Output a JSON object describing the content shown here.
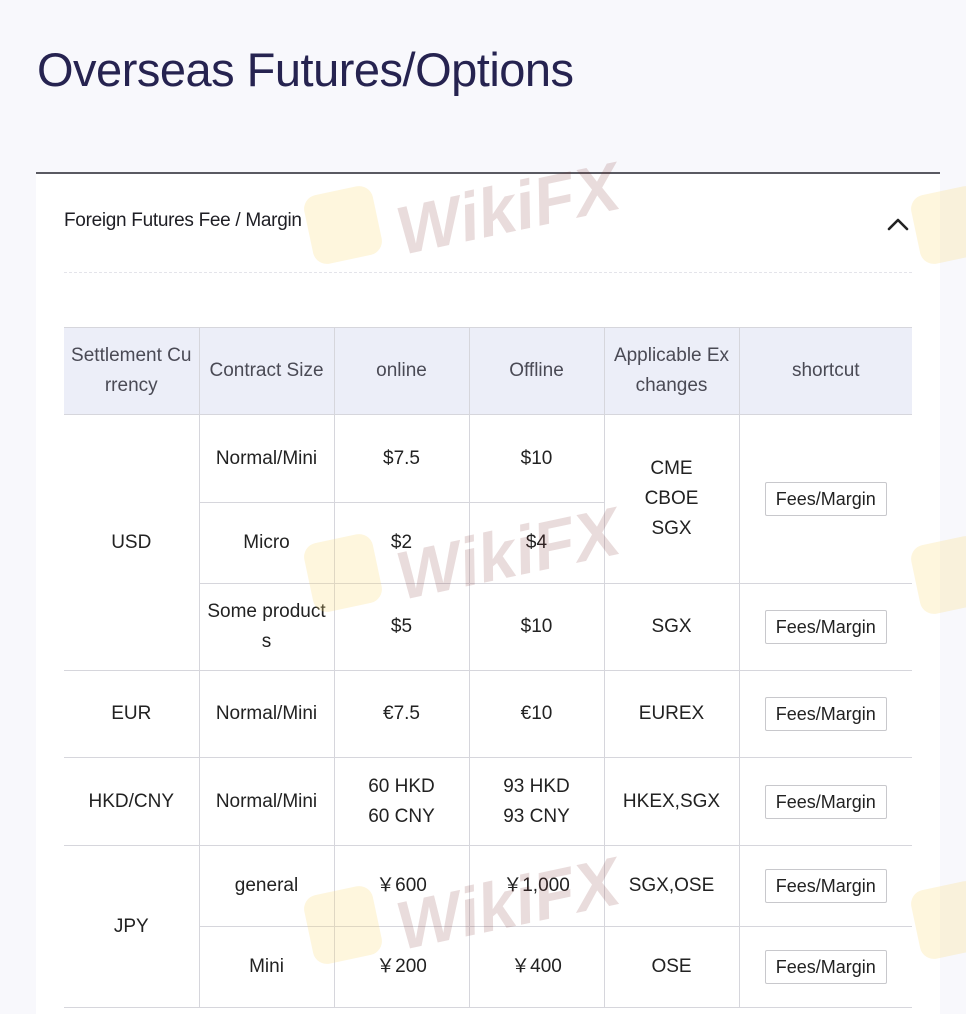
{
  "page": {
    "title": "Overseas Futures/Options"
  },
  "accordion": {
    "title": "Foreign Futures Fee / Margin",
    "toggle_icon": "chevron-up-icon",
    "expanded": true
  },
  "table": {
    "headers": [
      "Settlement Currency",
      "Contract Size",
      "online",
      "Offline",
      "Applicable Exchanges",
      "shortcut"
    ],
    "groups": [
      {
        "currency": "USD",
        "rows": [
          {
            "contract_size": "Normal/Mini",
            "online": "$7.5",
            "offline": "$10"
          },
          {
            "contract_size": "Micro",
            "online": "$2",
            "offline": "$4"
          },
          {
            "contract_size": "Some products",
            "online": "$5",
            "offline": "$10",
            "exchanges": "SGX",
            "shortcut": "Fees/Margin"
          }
        ],
        "shared_exchanges": "CME\nCBOE\nSGX",
        "shared_shortcut": "Fees/Margin"
      },
      {
        "currency": "EUR",
        "rows": [
          {
            "contract_size": "Normal/Mini",
            "online": "€7.5",
            "offline": "€10",
            "exchanges": "EUREX",
            "shortcut": "Fees/Margin"
          }
        ]
      },
      {
        "currency": "HKD/CNY",
        "rows": [
          {
            "contract_size": "Normal/Mini",
            "online": "60 HKD\n60 CNY",
            "offline": "93 HKD\n93 CNY",
            "exchanges": "HKEX,SGX",
            "shortcut": "Fees/Margin"
          }
        ]
      },
      {
        "currency": "JPY",
        "rows": [
          {
            "contract_size": "general",
            "online": "￥600",
            "offline": "￥1,000",
            "exchanges": "SGX,OSE",
            "shortcut": "Fees/Margin"
          },
          {
            "contract_size": "Mini",
            "online": "￥200",
            "offline": "￥400",
            "exchanges": "OSE",
            "shortcut": "Fees/Margin"
          }
        ]
      }
    ]
  },
  "watermark": {
    "text": "WikiFX"
  },
  "colors": {
    "title": "#262350",
    "header_bg": "#eceef8",
    "page_bg": "#f8f8fc",
    "border": "#d6d6dc"
  }
}
